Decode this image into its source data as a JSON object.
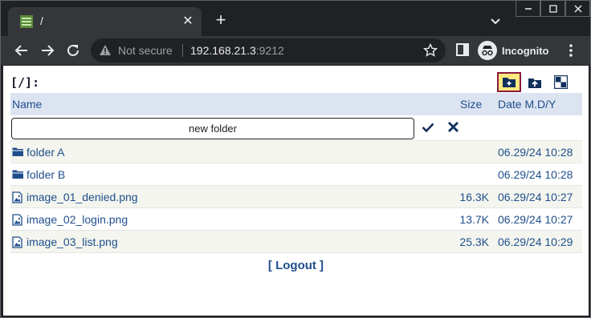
{
  "browser": {
    "tab_title": "/",
    "new_tab_label": "+",
    "not_secure": "Not secure",
    "url_host": "192.168.21.3",
    "url_port": ":9212",
    "profile_label": "Incognito"
  },
  "page": {
    "path": "[/]:",
    "columns": {
      "name": "Name",
      "size": "Size",
      "date": "Date M.D/Y"
    },
    "new_folder_value": "new folder",
    "rows": [
      {
        "type": "folder",
        "name": "folder A",
        "size": "",
        "date": "06.29/24 10:28"
      },
      {
        "type": "folder",
        "name": "folder B",
        "size": "",
        "date": "06.29/24 10:28"
      },
      {
        "type": "image",
        "name": "image_01_denied.png",
        "size": "16.3K",
        "date": "06.29/24 10:27"
      },
      {
        "type": "image",
        "name": "image_02_login.png",
        "size": "13.7K",
        "date": "06.29/24 10:27"
      },
      {
        "type": "image",
        "name": "image_03_list.png",
        "size": "25.3K",
        "date": "06.29/24 10:29"
      }
    ],
    "logout": "[ Logout ]"
  },
  "colors": {
    "link": "#1f4e8c",
    "header_bg": "#dce4f2",
    "active_tool_bg": "#ffe97f",
    "active_tool_border": "#8b1a3c"
  },
  "icons": [
    "spreadsheet-favicon-icon",
    "close-icon",
    "chevron-down-icon",
    "minimize-icon",
    "maximize-icon",
    "close-window-icon",
    "back-icon",
    "forward-icon",
    "reload-icon",
    "warning-icon",
    "star-icon",
    "reading-list-icon",
    "incognito-icon",
    "menu-icon",
    "new-folder-icon",
    "upload-icon",
    "select-icon",
    "checkmark-icon",
    "x-icon",
    "folder-icon",
    "image-file-icon"
  ]
}
